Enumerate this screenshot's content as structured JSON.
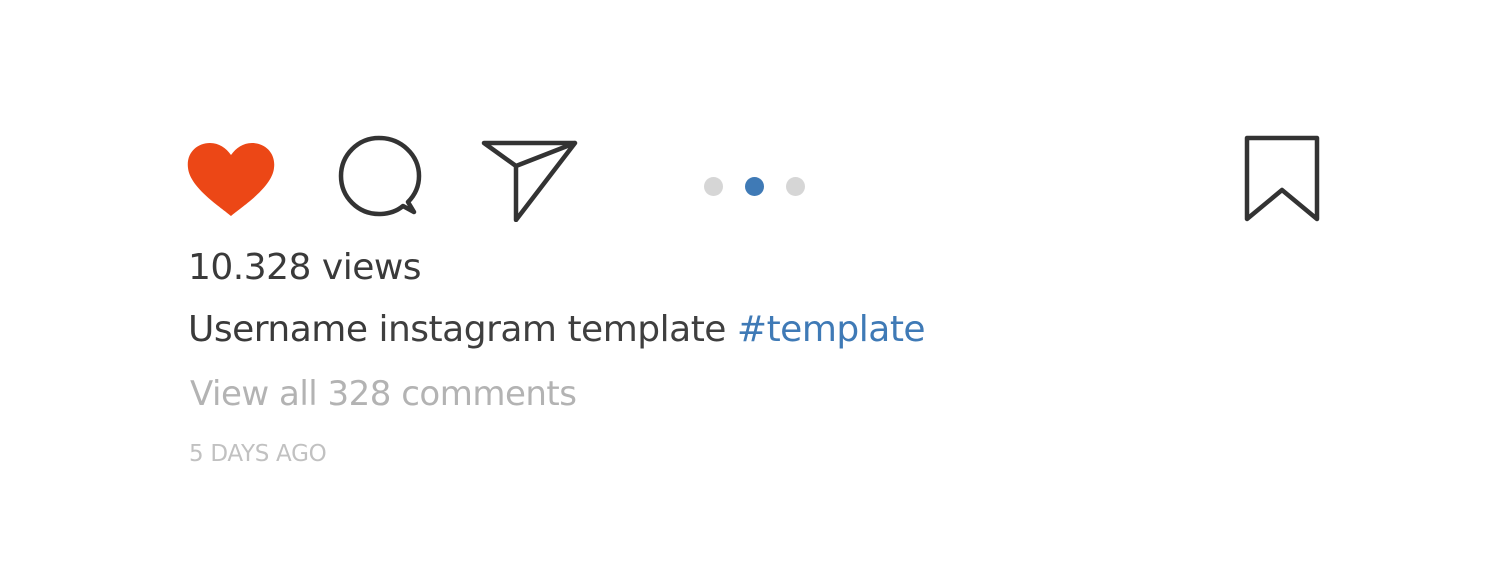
{
  "actions": {
    "like_icon": "heart-icon",
    "comment_icon": "comment-icon",
    "share_icon": "send-icon",
    "save_icon": "bookmark-icon",
    "like_color": "#ec4716",
    "icon_stroke_color": "#333333"
  },
  "carousel": {
    "dot_count": 3,
    "active_index": 1,
    "active_color": "#3f7ab6",
    "inactive_color": "#d6d6d6"
  },
  "post": {
    "views": "10.328 views",
    "username": "Username",
    "caption_text": "instagram template",
    "hashtag": "#template",
    "view_comments": "View all 328 comments",
    "timestamp": "5 DAYS AGO"
  }
}
